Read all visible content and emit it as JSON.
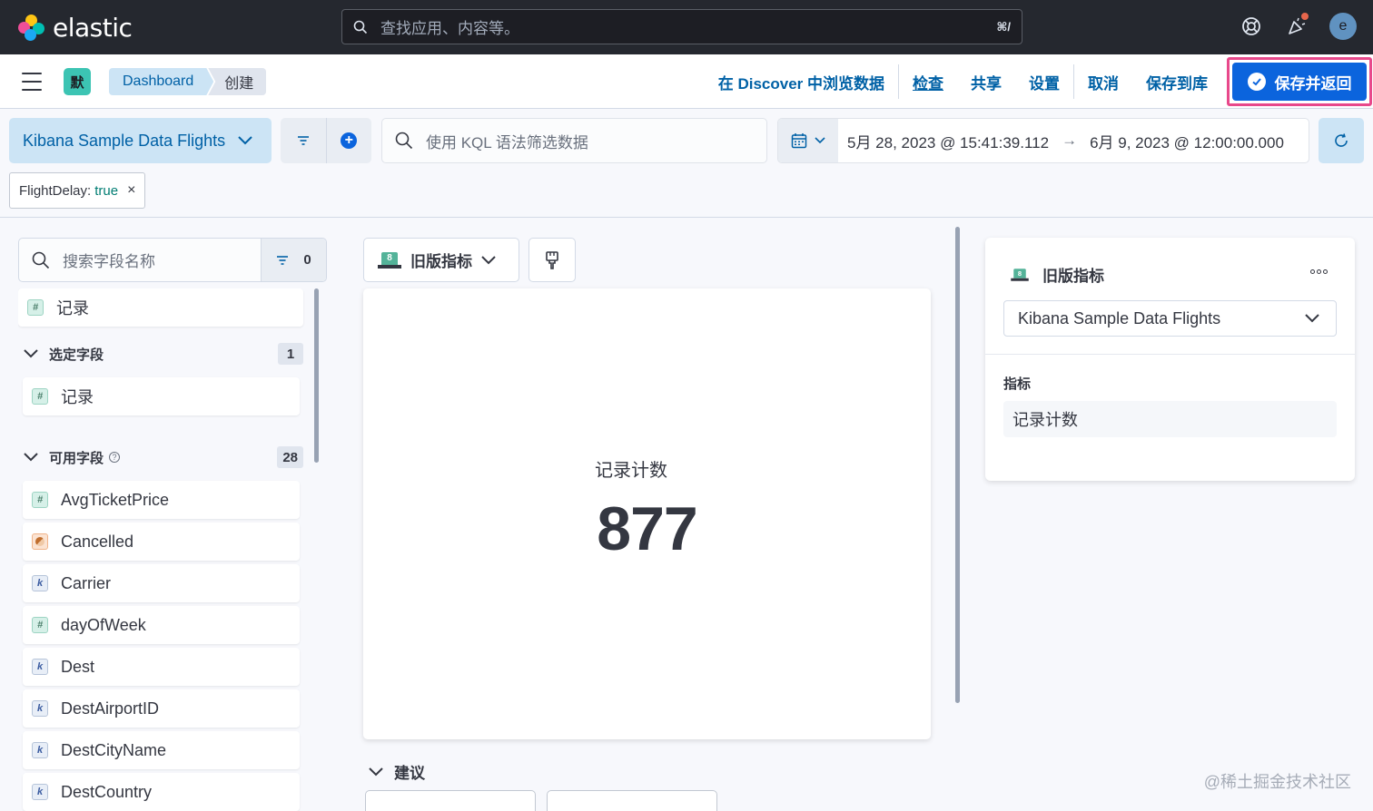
{
  "header": {
    "logo_text": "elastic",
    "search_placeholder": "查找应用、内容等。",
    "search_shortcut": "⌘/",
    "avatar_initial": "e"
  },
  "appbar": {
    "space_initial": "默",
    "breadcrumbs": [
      "Dashboard",
      "创建"
    ],
    "actions": {
      "discover": "在 Discover 中浏览数据",
      "inspect": "检查",
      "share": "共享",
      "settings": "设置",
      "cancel": "取消",
      "save_to_library": "保存到库",
      "save_and_return": "保存并返回"
    }
  },
  "querybar": {
    "data_view": "Kibana Sample Data Flights",
    "kql_placeholder": "使用 KQL 语法筛选数据",
    "date_start": "5月 28, 2023 @ 15:41:39.112",
    "date_arrow": "→",
    "date_end": "6月 9, 2023 @ 12:00:00.000",
    "filter": {
      "field": "FlightDelay:",
      "value": "true",
      "remove": "×"
    }
  },
  "fields": {
    "search_placeholder": "搜索字段名称",
    "filter_count": "0",
    "records_item": "记录",
    "selected_section": {
      "label": "选定字段",
      "count": "1",
      "items": [
        "记录"
      ]
    },
    "available_section": {
      "label": "可用字段",
      "help": "?",
      "count": "28",
      "items": [
        {
          "name": "AvgTicketPrice",
          "type": "number",
          "icon": "#"
        },
        {
          "name": "Cancelled",
          "type": "boolean",
          "icon": ""
        },
        {
          "name": "Carrier",
          "type": "keyword",
          "icon": "k"
        },
        {
          "name": "dayOfWeek",
          "type": "number",
          "icon": "#"
        },
        {
          "name": "Dest",
          "type": "keyword",
          "icon": "k"
        },
        {
          "name": "DestAirportID",
          "type": "keyword",
          "icon": "k"
        },
        {
          "name": "DestCityName",
          "type": "keyword",
          "icon": "k"
        },
        {
          "name": "DestCountry",
          "type": "keyword",
          "icon": "k"
        }
      ]
    }
  },
  "workspace": {
    "vis_type": "旧版指标",
    "vis_icon_number": "8",
    "metric_label": "记录计数",
    "metric_value": "877",
    "suggestions_label": "建议"
  },
  "config": {
    "title": "旧版指标",
    "vis_icon_number": "8",
    "layer_data_view": "Kibana Sample Data Flights",
    "section_label": "指标",
    "dimension": "记录计数"
  },
  "watermark": "@稀土掘金技术社区",
  "colors": {
    "header_bg": "#25282f",
    "accent": "#0b64dd",
    "link": "#0061a6",
    "highlight_border": "#e8488b",
    "space_badge": "#3cc4b3",
    "metric_vis_green": "#54b399"
  }
}
